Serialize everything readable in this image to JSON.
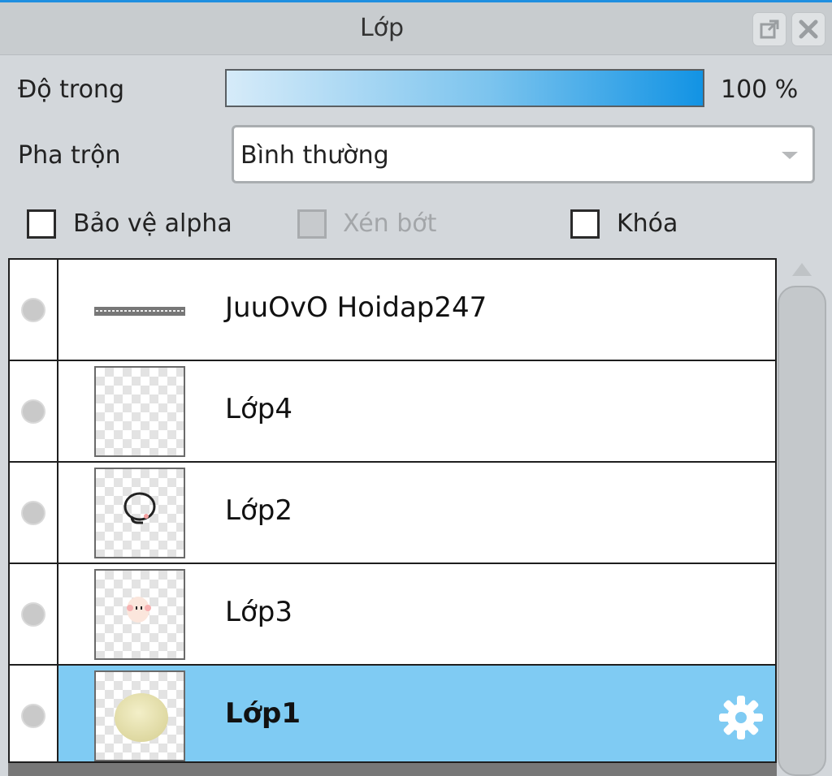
{
  "window": {
    "title": "Lớp",
    "popout_icon": "popout-icon",
    "close_icon": "close-icon"
  },
  "opacity": {
    "label": "Độ trong",
    "value_text": "100 %",
    "value": 1.0
  },
  "blend": {
    "label": "Pha trộn",
    "selected": "Bình thường"
  },
  "options": {
    "protect_alpha": {
      "label": "Bảo vệ alpha",
      "checked": false,
      "enabled": true
    },
    "clipping": {
      "label": "Xén bớt",
      "checked": false,
      "enabled": false
    },
    "lock": {
      "label": "Khóa",
      "checked": false,
      "enabled": true
    }
  },
  "layers": [
    {
      "name": "JuuOvO Hoidap247",
      "type": "text",
      "selected": false
    },
    {
      "name": "Lớp4",
      "type": "raster",
      "selected": false
    },
    {
      "name": "Lớp2",
      "type": "raster",
      "selected": false
    },
    {
      "name": "Lớp3",
      "type": "raster",
      "selected": false
    },
    {
      "name": "Lớp1",
      "type": "raster",
      "selected": true,
      "icon": "gear-icon"
    }
  ],
  "colors": {
    "accent": "#1293e4",
    "selected_row": "#7fcbf3",
    "panel_bg": "#d3d7db"
  }
}
